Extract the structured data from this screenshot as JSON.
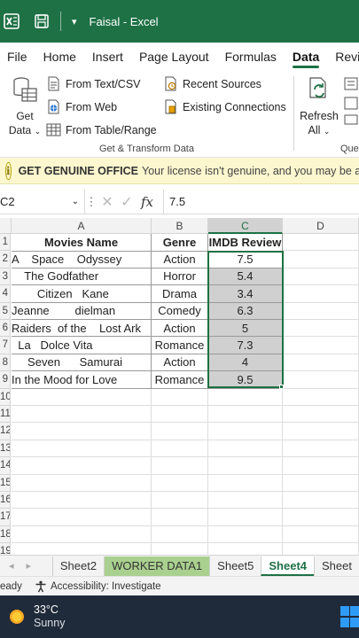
{
  "titlebar": {
    "user": "Faisal",
    "app": "Excel",
    "separator": " - ",
    "bg_color": "#1e7145"
  },
  "menu": {
    "tabs": [
      "File",
      "Home",
      "Insert",
      "Page Layout",
      "Formulas",
      "Data",
      "Review"
    ],
    "active": "Data"
  },
  "ribbon": {
    "get_data_label": "Get",
    "get_data_label2": "Data",
    "from_text_csv": "From Text/CSV",
    "from_web": "From Web",
    "from_table_range": "From Table/Range",
    "recent_sources": "Recent Sources",
    "existing_connections": "Existing Connections",
    "group_label": "Get & Transform Data",
    "refresh_label": "Refresh",
    "refresh_label2": "All",
    "queries_group_label": "Quer"
  },
  "infobar": {
    "title": "GET GENUINE OFFICE",
    "message": "Your license isn't genuine, and you may be a victim of software counterfeiting."
  },
  "formula_bar": {
    "name_box": "C2",
    "fx": "fx",
    "value": "7.5"
  },
  "grid": {
    "columns": [
      "A",
      "B",
      "C",
      "D"
    ],
    "selected_column": "C",
    "row_numbers": [
      "1",
      "2",
      "3",
      "4",
      "5",
      "6",
      "7",
      "8",
      "9",
      "10",
      "11",
      "12",
      "13",
      "14",
      "15",
      "16",
      "17",
      "18",
      "19"
    ],
    "headers": [
      "Movies Name",
      "Genre",
      "IMDB Review"
    ],
    "rows": [
      {
        "movie": "A    Space    Odyssey",
        "genre": "Action",
        "review": "7.5"
      },
      {
        "movie": "    The Godfather",
        "genre": "Horror",
        "review": "5.4"
      },
      {
        "movie": "        Citizen   Kane",
        "genre": "Drama",
        "review": "3.4"
      },
      {
        "movie": "Jeanne        dielman",
        "genre": "Comedy",
        "review": "6.3"
      },
      {
        "movie": "Raiders  of the    Lost Ark",
        "genre": "Action",
        "review": "5"
      },
      {
        "movie": "  La   Dolce Vita",
        "genre": "Romance",
        "review": "7.3"
      },
      {
        "movie": "     Seven      Samurai",
        "genre": "Action",
        "review": "4"
      },
      {
        "movie": "In the Mood for Love",
        "genre": "Romance",
        "review": "9.5"
      }
    ]
  },
  "sheets": {
    "tabs": [
      "Sheet2",
      "WORKER DATA1",
      "Sheet5",
      "Sheet4",
      "Sheet"
    ],
    "active": "Sheet4",
    "highlighted": "WORKER DATA1"
  },
  "statusbar": {
    "ready": "eady",
    "accessibility": "Accessibility: Investigate"
  },
  "taskbar": {
    "temperature": "33°C",
    "condition": "Sunny"
  }
}
